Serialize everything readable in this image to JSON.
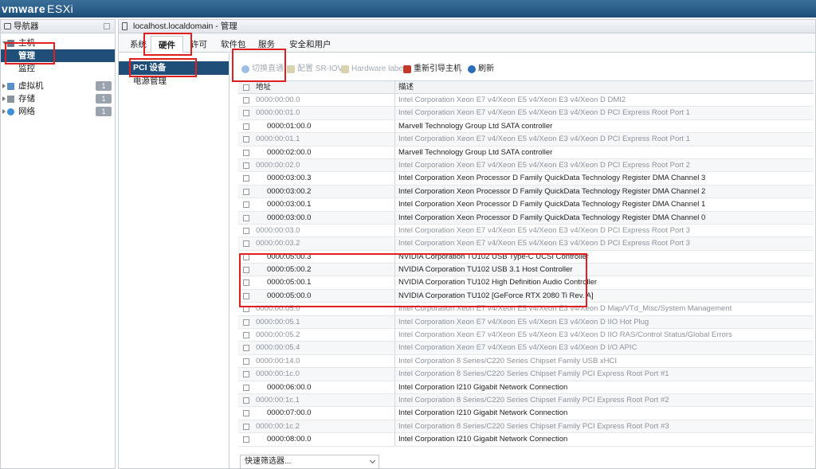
{
  "app": {
    "brand_vm": "vmware",
    "brand_product": "ESXi"
  },
  "navigator": {
    "title": "导航器",
    "host_label": "主机",
    "host_children": [
      "管理",
      "监控"
    ],
    "items": [
      {
        "label": "虚拟机",
        "count": "1"
      },
      {
        "label": "存储",
        "count": "1"
      },
      {
        "label": "网络",
        "count": "1"
      }
    ]
  },
  "main": {
    "title": "localhost.localdomain - 管理",
    "tabs": [
      "系统",
      "硬件",
      "许可",
      "软件包",
      "服务",
      "安全和用户"
    ],
    "active_tab": "硬件",
    "subnav": [
      "PCI 设备",
      "电源管理"
    ],
    "toolbar": {
      "toggle_passthrough": "切换直通",
      "configure_sriov": "配置 SR-IOV",
      "hardware_label": "Hardware label",
      "reboot_host": "重新引导主机",
      "refresh": "刷新"
    },
    "table": {
      "headers": [
        "地址",
        "描述"
      ],
      "rows": [
        {
          "addr": "0000:00:00.0",
          "desc": "Intel Corporation Xeon E7 v4/Xeon E5 v4/Xeon E3 v4/Xeon D DMI2",
          "dim": true,
          "child": false
        },
        {
          "addr": "0000:00:01.0",
          "desc": "Intel Corporation Xeon E7 v4/Xeon E5 v4/Xeon E3 v4/Xeon D PCI Express Root Port 1",
          "dim": true,
          "child": false
        },
        {
          "addr": "0000:01:00.0",
          "desc": "Marvell Technology Group Ltd SATA controller",
          "dim": false,
          "child": true
        },
        {
          "addr": "0000:00:01.1",
          "desc": "Intel Corporation Xeon E7 v4/Xeon E5 v4/Xeon E3 v4/Xeon D PCI Express Root Port 1",
          "dim": true,
          "child": false
        },
        {
          "addr": "0000:02:00.0",
          "desc": "Marvell Technology Group Ltd SATA controller",
          "dim": false,
          "child": true
        },
        {
          "addr": "0000:00:02.0",
          "desc": "Intel Corporation Xeon E7 v4/Xeon E5 v4/Xeon E3 v4/Xeon D PCI Express Root Port 2",
          "dim": true,
          "child": false
        },
        {
          "addr": "0000:03:00.3",
          "desc": "Intel Corporation Xeon Processor D Family QuickData Technology Register DMA Channel 3",
          "dim": false,
          "child": true
        },
        {
          "addr": "0000:03:00.2",
          "desc": "Intel Corporation Xeon Processor D Family QuickData Technology Register DMA Channel 2",
          "dim": false,
          "child": true
        },
        {
          "addr": "0000:03:00.1",
          "desc": "Intel Corporation Xeon Processor D Family QuickData Technology Register DMA Channel 1",
          "dim": false,
          "child": true
        },
        {
          "addr": "0000:03:00.0",
          "desc": "Intel Corporation Xeon Processor D Family QuickData Technology Register DMA Channel 0",
          "dim": false,
          "child": true
        },
        {
          "addr": "0000:00:03.0",
          "desc": "Intel Corporation Xeon E7 v4/Xeon E5 v4/Xeon E3 v4/Xeon D PCI Express Root Port 3",
          "dim": true,
          "child": false
        },
        {
          "addr": "0000:00:03.2",
          "desc": "Intel Corporation Xeon E7 v4/Xeon E5 v4/Xeon E3 v4/Xeon D PCI Express Root Port 3",
          "dim": true,
          "child": false
        },
        {
          "addr": "0000:05:00.3",
          "desc": "NVIDIA Corporation TU102 USB Type-C UCSI Controller",
          "dim": false,
          "child": true
        },
        {
          "addr": "0000:05:00.2",
          "desc": "NVIDIA Corporation TU102 USB 3.1 Host Controller",
          "dim": false,
          "child": true
        },
        {
          "addr": "0000:05:00.1",
          "desc": "NVIDIA Corporation TU102 High Definition Audio Controller",
          "dim": false,
          "child": true
        },
        {
          "addr": "0000:05:00.0",
          "desc": "NVIDIA Corporation TU102 [GeForce RTX 2080 Ti Rev. A]",
          "dim": false,
          "child": true
        },
        {
          "addr": "0000:00:05.0",
          "desc": "Intel Corporation Xeon E7 v4/Xeon E5 v4/Xeon E3 v4/Xeon D Map/VTd_Misc/System Management",
          "dim": true,
          "child": false
        },
        {
          "addr": "0000:00:05.1",
          "desc": "Intel Corporation Xeon E7 v4/Xeon E5 v4/Xeon E3 v4/Xeon D IIO Hot Plug",
          "dim": true,
          "child": false
        },
        {
          "addr": "0000:00:05.2",
          "desc": "Intel Corporation Xeon E7 v4/Xeon E5 v4/Xeon E3 v4/Xeon D IIO RAS/Control Status/Global Errors",
          "dim": true,
          "child": false
        },
        {
          "addr": "0000:00:05.4",
          "desc": "Intel Corporation Xeon E7 v4/Xeon E5 v4/Xeon E3 v4/Xeon D I/O APIC",
          "dim": true,
          "child": false
        },
        {
          "addr": "0000:00:14.0",
          "desc": "Intel Corporation 8 Series/C220 Series Chipset Family USB xHCI",
          "dim": true,
          "child": false
        },
        {
          "addr": "0000:00:1c.0",
          "desc": "Intel Corporation 8 Series/C220 Series Chipset Family PCI Express Root Port #1",
          "dim": true,
          "child": false
        },
        {
          "addr": "0000:06:00.0",
          "desc": "Intel Corporation I210 Gigabit Network Connection",
          "dim": false,
          "child": true
        },
        {
          "addr": "0000:00:1c.1",
          "desc": "Intel Corporation 8 Series/C220 Series Chipset Family PCI Express Root Port #2",
          "dim": true,
          "child": false
        },
        {
          "addr": "0000:07:00.0",
          "desc": "Intel Corporation I210 Gigabit Network Connection",
          "dim": false,
          "child": true
        },
        {
          "addr": "0000:00:1c.2",
          "desc": "Intel Corporation 8 Series/C220 Series Chipset Family PCI Express Root Port #3",
          "dim": true,
          "child": false
        },
        {
          "addr": "0000:08:00.0",
          "desc": "Intel Corporation I210 Gigabit Network Connection",
          "dim": false,
          "child": true
        }
      ]
    },
    "filter_placeholder": "快速筛选器..."
  },
  "colors": {
    "topbar": "#1f4f79",
    "selection": "#1f4e78",
    "highlight": "#e02020"
  }
}
